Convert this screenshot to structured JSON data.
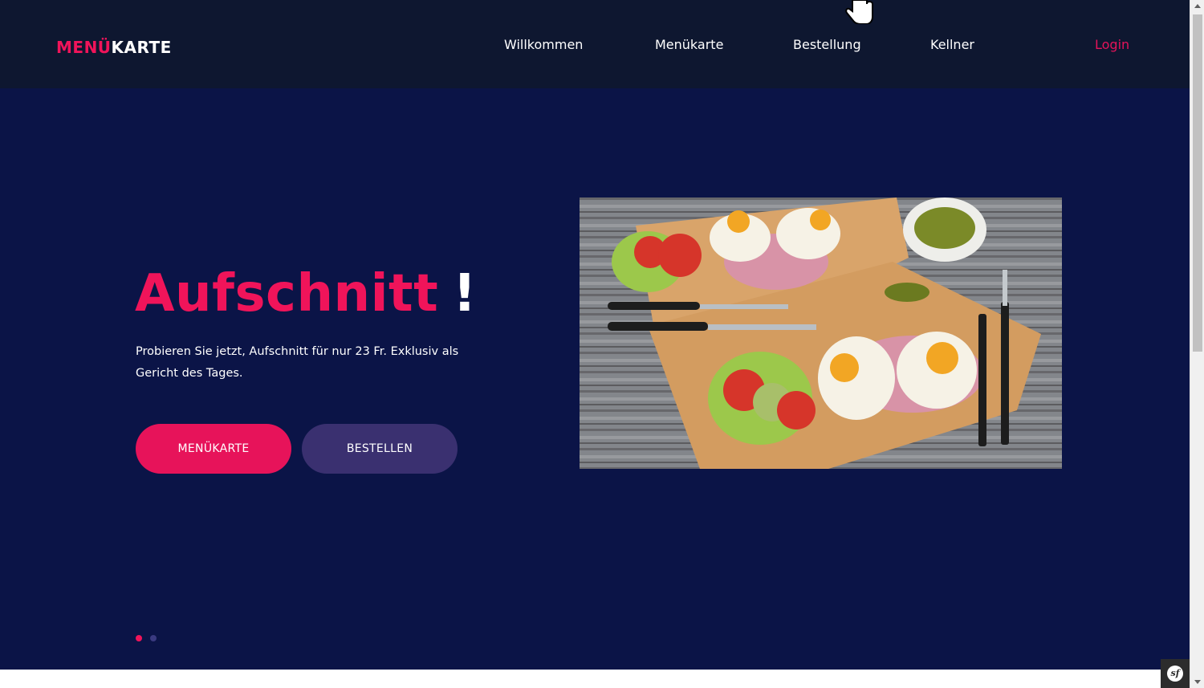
{
  "logo": {
    "accent": "MENÜ",
    "rest": "KARTE"
  },
  "nav": {
    "items": [
      {
        "label": "Willkommen"
      },
      {
        "label": "Menükarte"
      },
      {
        "label": "Bestellung"
      },
      {
        "label": "Kellner"
      }
    ],
    "login": "Login"
  },
  "hero": {
    "title": "Aufschnitt",
    "title_suffix": "!",
    "description": "Probieren Sie jetzt, Aufschnitt für nur 23 Fr. Exklusiv als Gericht des Tages.",
    "primary_button": "MENÜKARTE",
    "secondary_button": "BESTELLEN",
    "carousel": {
      "slides": 2,
      "active": 1
    }
  },
  "devtools": {
    "badge_label": "sf"
  },
  "colors": {
    "accent": "#f0145a",
    "navbar_bg": "#0e1730",
    "hero_bg": "#0b1447",
    "secondary_button": "#3a3070"
  }
}
